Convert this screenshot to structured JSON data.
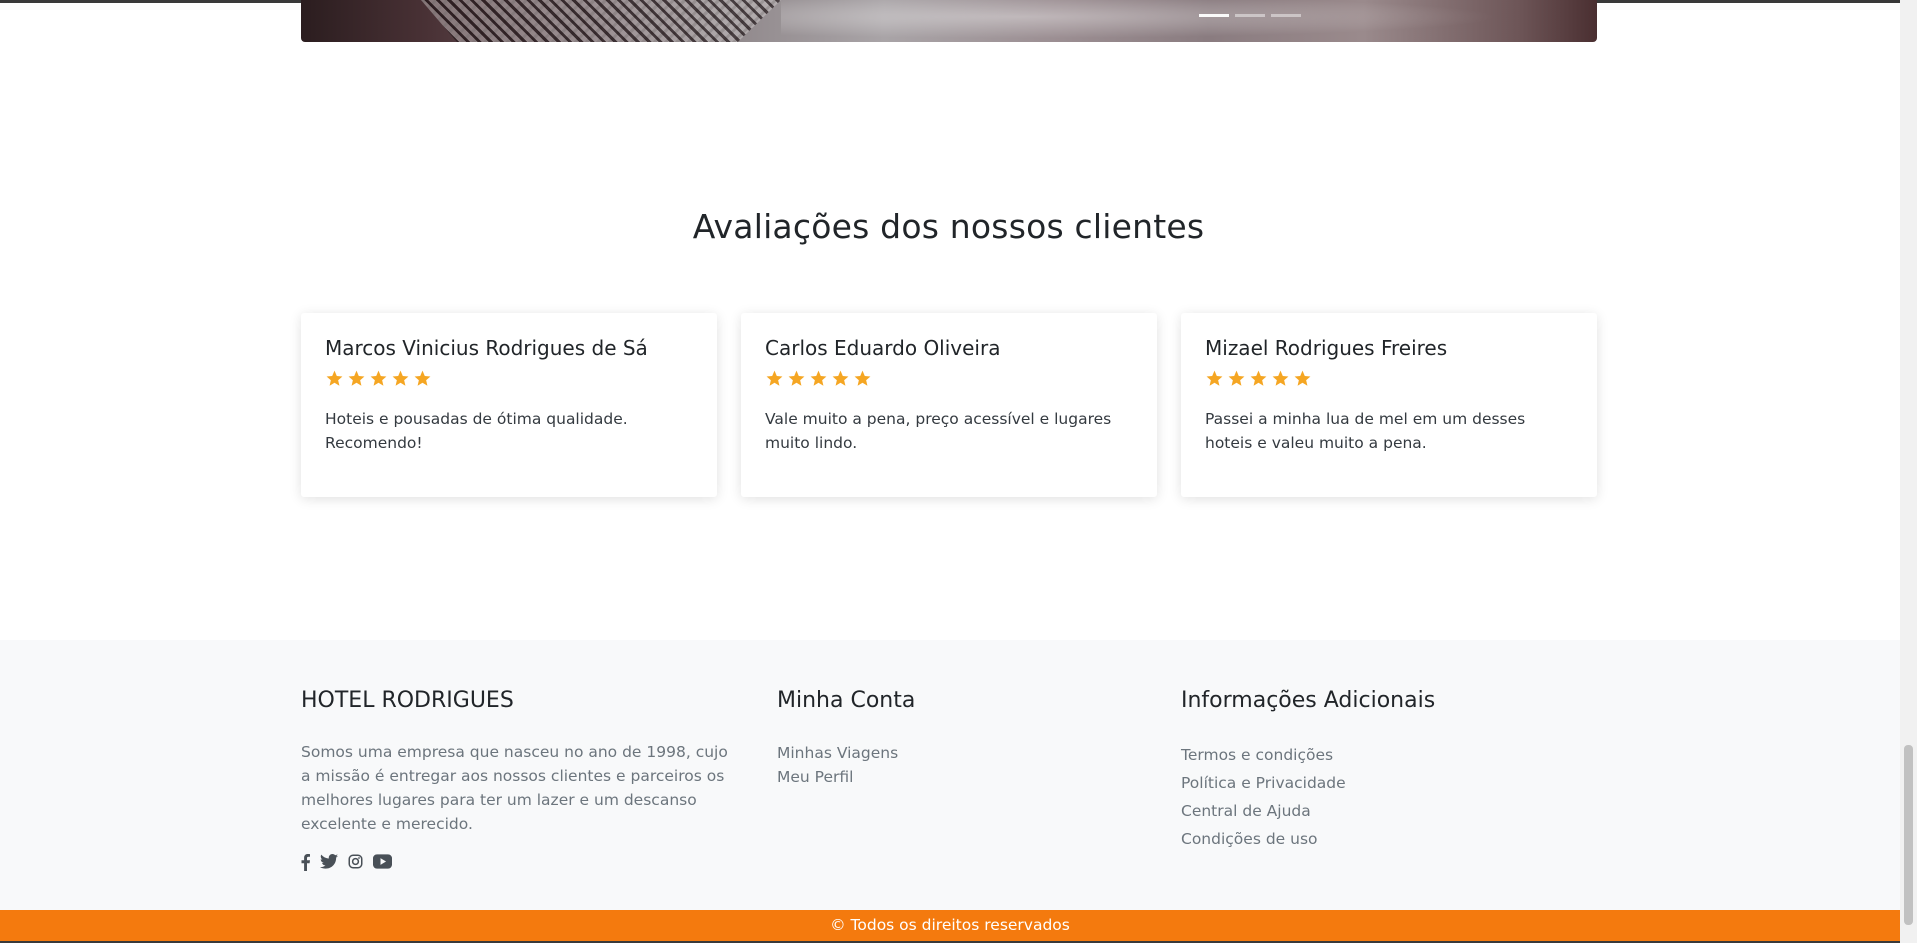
{
  "carousel": {
    "indicator_count": 3,
    "active_index": 0
  },
  "reviews": {
    "title": "Avaliações dos nossos clientes",
    "star_color": "#f5a623",
    "items": [
      {
        "name": "Marcos Vinicius Rodrigues de Sá",
        "rating": 5,
        "text": "Hoteis e pousadas de ótima qualidade. Recomendo!"
      },
      {
        "name": "Carlos Eduardo Oliveira",
        "rating": 5,
        "text": "Vale muito a pena, preço acessível e lugares muito lindo."
      },
      {
        "name": "Mizael Rodrigues Freires",
        "rating": 5,
        "text": "Passei a minha lua de mel em um desses hoteis e valeu muito a pena."
      }
    ]
  },
  "footer": {
    "brand": {
      "title": "HOTEL RODRIGUES",
      "about": "Somos uma empresa que nasceu no ano de 1998, cujo a missão é entregar aos nossos clientes e parceiros os melhores lugares para ter um lazer e um descanso excelente e merecido."
    },
    "social": [
      "facebook-icon",
      "twitter-icon",
      "instagram-icon",
      "youtube-icon"
    ],
    "account": {
      "title": "Minha Conta",
      "links": [
        "Minhas Viagens",
        "Meu Perfil"
      ]
    },
    "info": {
      "title": "Informações Adicionais",
      "links": [
        "Termos e condições",
        "Política e Privacidade",
        "Central de Ajuda",
        "Condições de uso"
      ]
    }
  },
  "copyright": "© Todos os direitos reservados",
  "colors": {
    "accent": "#f47a0e",
    "footer_bg": "#f8f9fa"
  }
}
